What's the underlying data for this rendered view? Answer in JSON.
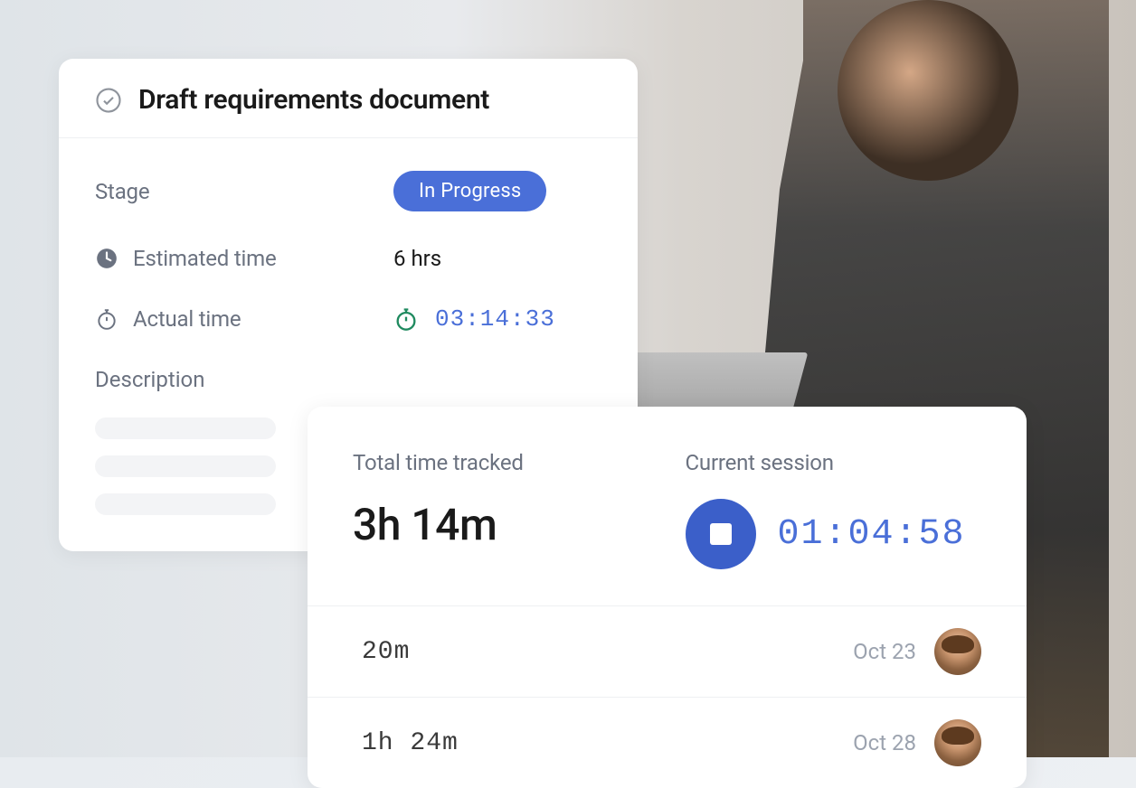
{
  "task": {
    "title": "Draft requirements document",
    "stage_label": "Stage",
    "stage_value": "In Progress",
    "estimated_label": "Estimated time",
    "estimated_value": "6 hrs",
    "actual_label": "Actual time",
    "actual_value": "03:14:33",
    "description_label": "Description"
  },
  "tracking": {
    "total_label": "Total time tracked",
    "total_value": "3h 14m",
    "session_label": "Current session",
    "session_value": "01:04:58",
    "entries": [
      {
        "duration": "20m",
        "date": "Oct 23"
      },
      {
        "duration": "1h 24m",
        "date": "Oct 28"
      }
    ]
  },
  "colors": {
    "accent": "#4a6fd8",
    "text_muted": "#6b7280"
  }
}
